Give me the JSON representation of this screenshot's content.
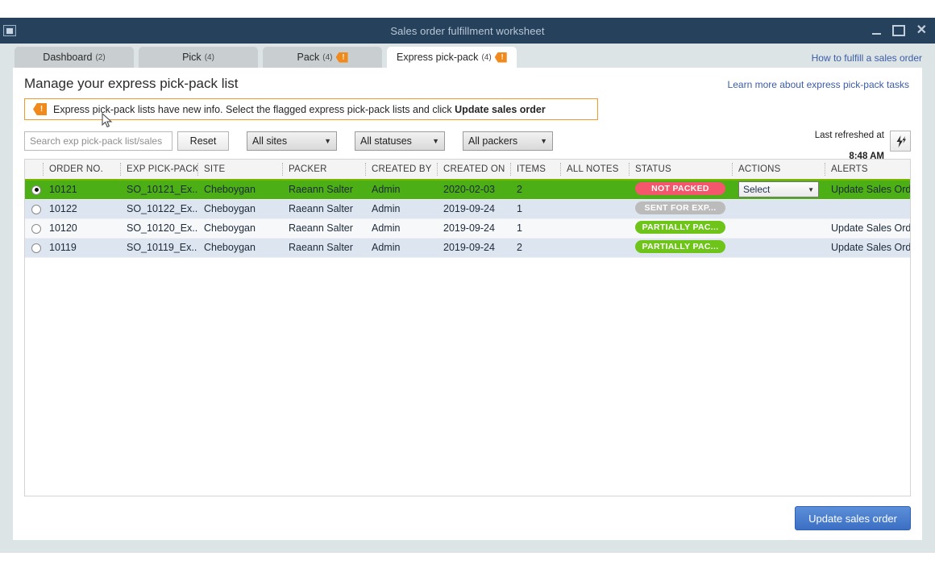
{
  "window": {
    "title": "Sales order fulfillment worksheet",
    "app_icon": "window-icon",
    "minimize": "–",
    "maximize": "□",
    "close": "✕"
  },
  "tabs": [
    {
      "label": "Dashboard",
      "count": "(2)",
      "flag": false,
      "active": false
    },
    {
      "label": "Pick",
      "count": "(4)",
      "flag": false,
      "active": false
    },
    {
      "label": "Pack",
      "count": "(4)",
      "flag": true,
      "active": false
    },
    {
      "label": "Express pick-pack",
      "count": "(4)",
      "flag": true,
      "active": true
    }
  ],
  "header": {
    "howto_link": "How to fulfill a sales order",
    "page_title": "Manage your express pick-pack list",
    "learn_link": "Learn more about express pick-pack tasks"
  },
  "banner": {
    "icon": "alert-flag-icon",
    "text_before": "Express pick-pack lists have new info. Select the flagged express pick-pack lists and click",
    "text_bold": "Update sales order"
  },
  "toolbar": {
    "search_placeholder": "Search exp pick-pack list/sales",
    "search_value": "",
    "reset_label": "Reset",
    "filters": [
      {
        "label": "All sites",
        "name": "sites-filter"
      },
      {
        "label": "All statuses",
        "name": "statuses-filter"
      },
      {
        "label": "All packers",
        "name": "packers-filter"
      }
    ],
    "refresh_label": "Last refreshed at",
    "refresh_time": "8:48 AM",
    "refresh_icon": "refresh-lightning-icon"
  },
  "table": {
    "columns": [
      "ORDER NO.",
      "EXP PICK-PACK L",
      "SITE",
      "PACKER",
      "CREATED BY",
      "CREATED ON",
      "ITEMS",
      "ALL NOTES",
      "STATUS",
      "ACTIONS",
      "ALERTS"
    ],
    "rows": [
      {
        "selected": true,
        "order_no": "10121",
        "pick_pack_list": "SO_10121_Ex...",
        "site": "Cheboygan",
        "packer": "Raeann Salter",
        "created_by": "Admin",
        "created_on": "2020-02-03",
        "items": "2",
        "all_notes": "",
        "status": "NOT PACKED",
        "status_color": "red",
        "action": "Select",
        "has_action": true,
        "alert": "Update Sales Order",
        "has_alert": true
      },
      {
        "selected": false,
        "order_no": "10122",
        "pick_pack_list": "SO_10122_Ex...",
        "site": "Cheboygan",
        "packer": "Raeann Salter",
        "created_by": "Admin",
        "created_on": "2019-09-24",
        "items": "1",
        "all_notes": "",
        "status": "SENT FOR EXP...",
        "status_color": "gray",
        "action": "",
        "has_action": false,
        "alert": "",
        "has_alert": false
      },
      {
        "selected": false,
        "order_no": "10120",
        "pick_pack_list": "SO_10120_Ex...",
        "site": "Cheboygan",
        "packer": "Raeann Salter",
        "created_by": "Admin",
        "created_on": "2019-09-24",
        "items": "1",
        "all_notes": "",
        "status": "PARTIALLY PAC...",
        "status_color": "green",
        "action": "",
        "has_action": false,
        "alert": "Update Sales Order",
        "has_alert": true
      },
      {
        "selected": false,
        "order_no": "10119",
        "pick_pack_list": "SO_10119_Ex...",
        "site": "Cheboygan",
        "packer": "Raeann Salter",
        "created_by": "Admin",
        "created_on": "2019-09-24",
        "items": "2",
        "all_notes": "",
        "status": "PARTIALLY PAC...",
        "status_color": "green",
        "action": "",
        "has_action": false,
        "alert": "Update Sales Order",
        "has_alert": true
      }
    ]
  },
  "footer": {
    "update_label": "Update sales order"
  },
  "colors": {
    "titlebar": "#26415c",
    "selected_row": "#4caf16",
    "accent_green": "#7ab800",
    "alert_orange": "#f08a1c",
    "link_blue": "#3b5ca8",
    "primary_button": "#3c6fc4",
    "badge_red": "#f4566b",
    "badge_gray": "#bbbbbb",
    "badge_green": "#6fc41a"
  }
}
